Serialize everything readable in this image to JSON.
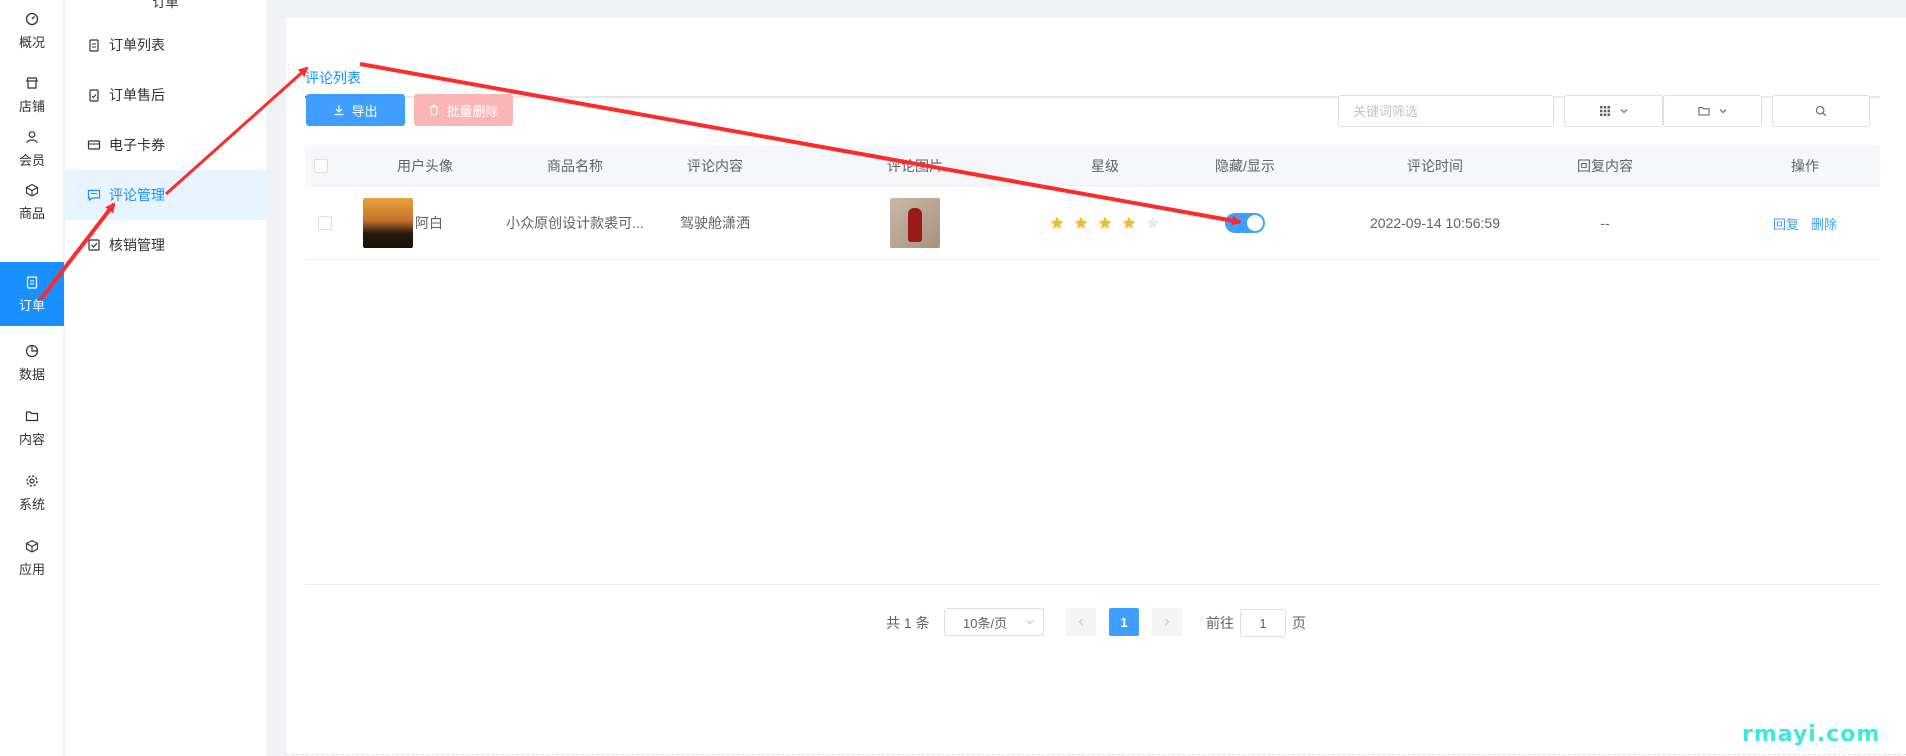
{
  "rail": {
    "items": [
      {
        "label": "概况",
        "icon": "dashboard-icon"
      },
      {
        "label": "店铺",
        "icon": "store-icon"
      },
      {
        "label": "会员",
        "icon": "user-icon"
      },
      {
        "label": "商品",
        "icon": "box-icon"
      },
      {
        "label": "订单",
        "icon": "order-icon",
        "active": true
      },
      {
        "label": "数据",
        "icon": "pie-chart-icon"
      },
      {
        "label": "内容",
        "icon": "folder-icon"
      },
      {
        "label": "系统",
        "icon": "gear-icon"
      },
      {
        "label": "应用",
        "icon": "cube-icon"
      }
    ]
  },
  "submenu": {
    "title": "订单",
    "items": [
      {
        "label": "订单列表",
        "icon": "clipboard-icon"
      },
      {
        "label": "订单售后",
        "icon": "clipboard-check-icon"
      },
      {
        "label": "电子卡券",
        "icon": "card-icon"
      },
      {
        "label": "评论管理",
        "icon": "comment-icon",
        "active": true
      },
      {
        "label": "核销管理",
        "icon": "checkbox-icon"
      }
    ]
  },
  "tabs": {
    "active": "评论列表"
  },
  "toolbar": {
    "export_label": "导出",
    "batch_delete_label": "批量删除",
    "search_placeholder": "关键词筛选"
  },
  "table": {
    "columns": [
      "用户头像",
      "商品名称",
      "评论内容",
      "评论图片",
      "星级",
      "隐藏/显示",
      "评论时间",
      "回复内容",
      "操作"
    ],
    "rows": [
      {
        "user": "阿白",
        "product": "小众原创设计款裘可...",
        "content": "驾驶舱潇洒",
        "stars": 4,
        "max_stars": 5,
        "visible": true,
        "time": "2022-09-14 10:56:59",
        "reply": "--",
        "actions": [
          "回复",
          "删除"
        ]
      }
    ]
  },
  "pagination": {
    "total": "共 1 条",
    "page_size": "10条/页",
    "current_page": "1",
    "goto_prefix": "前往",
    "goto_value": "1",
    "goto_suffix": "页"
  },
  "colors": {
    "primary": "#409eff",
    "menu_active": "#1890ff",
    "star": "#f7ba2a",
    "annotation": "#ff2a2a"
  },
  "watermark": "rmayi.com"
}
